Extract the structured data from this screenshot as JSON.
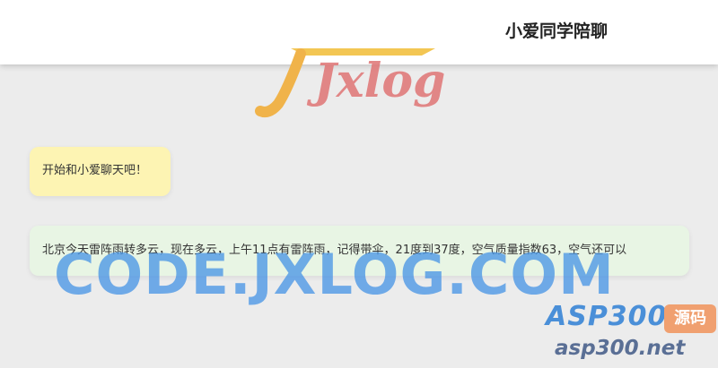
{
  "header": {
    "title": "小爱同学陪聊"
  },
  "logo": {
    "text": "Jxlog"
  },
  "messages": [
    {
      "text": "开始和小爱聊天吧！",
      "color": "#fdf4b3"
    },
    {
      "text": "北京今天雷阵雨转多云，现在多云，上午11点有雷阵雨，记得带伞，21度到37度，空气质量指数63，空气还可以",
      "color": "#e8f5e4"
    }
  ],
  "watermark": {
    "main": "CODE.JXLOG.COM",
    "brand": "ASP300",
    "tag": "源码",
    "url": "asp300.net"
  },
  "colors": {
    "page_bg": "#ececec",
    "header_bg": "#ffffff",
    "watermark": "#4a96e6"
  }
}
